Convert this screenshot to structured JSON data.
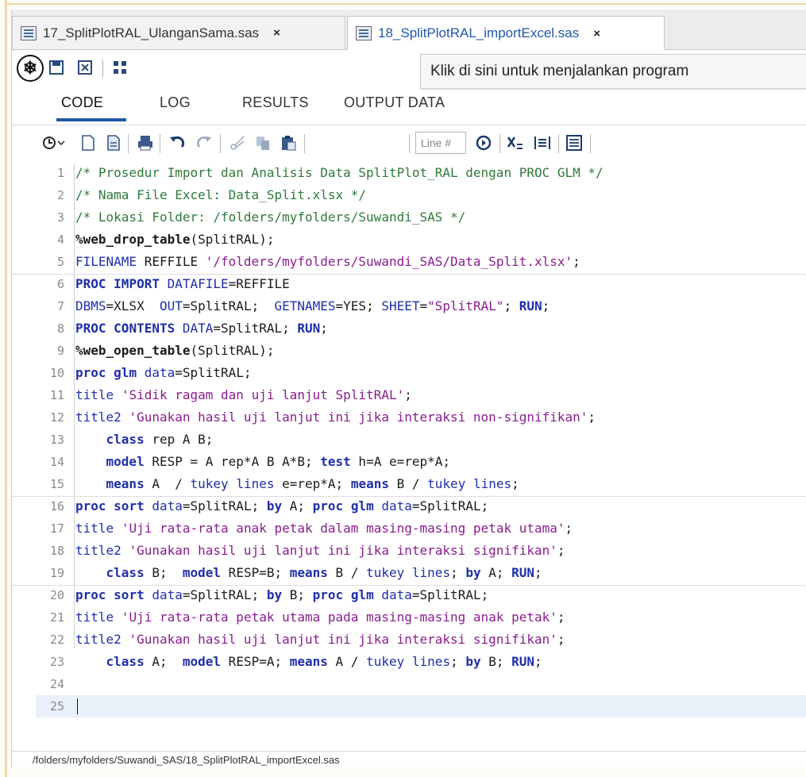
{
  "tabs": [
    {
      "label": "17_SplitPlotRAL_UlanganSama.sas",
      "close": "×"
    },
    {
      "label": "18_SplitPlotRAL_importExcel.sas",
      "close": "×"
    }
  ],
  "tooltip": "Klik di sini untuk menjalankan program",
  "section_tabs": [
    "CODE",
    "LOG",
    "RESULTS",
    "OUTPUT DATA"
  ],
  "linebox_placeholder": "Line #",
  "code_lines": [
    {
      "n": "1",
      "text": "/* Prosedur Import dan Analisis Data SplitPlot_RAL dengan PROC GLM */"
    },
    {
      "n": "2",
      "text": "/* Nama File Excel: Data_Split.xlsx */"
    },
    {
      "n": "3",
      "text": "/* Lokasi Folder: /folders/myfolders/Suwandi_SAS */"
    },
    {
      "n": "4",
      "text": "%web_drop_table(SplitRAL);"
    },
    {
      "n": "5",
      "text": "FILENAME REFFILE '/folders/myfolders/Suwandi_SAS/Data_Split.xlsx';"
    },
    {
      "n": "6",
      "text": "PROC IMPORT DATAFILE=REFFILE"
    },
    {
      "n": "7",
      "text": "DBMS=XLSX  OUT=SplitRAL;  GETNAMES=YES; SHEET=\"SplitRAL\"; RUN;"
    },
    {
      "n": "8",
      "text": "PROC CONTENTS DATA=SplitRAL; RUN;"
    },
    {
      "n": "9",
      "text": "%web_open_table(SplitRAL);"
    },
    {
      "n": "10",
      "text": "proc glm data=SplitRAL;"
    },
    {
      "n": "11",
      "text": "title 'Sidik ragam dan uji lanjut SplitRAL';"
    },
    {
      "n": "12",
      "text": "title2 'Gunakan hasil uji lanjut ini jika interaksi non-signifikan';"
    },
    {
      "n": "13",
      "text": "    class rep A B;"
    },
    {
      "n": "14",
      "text": "    model RESP = A rep*A B A*B; test h=A e=rep*A;"
    },
    {
      "n": "15",
      "text": "    means A  / tukey lines e=rep*A; means B / tukey lines;"
    },
    {
      "n": "16",
      "text": "proc sort data=SplitRAL; by A; proc glm data=SplitRAL;"
    },
    {
      "n": "17",
      "text": "title 'Uji rata-rata anak petak dalam masing-masing petak utama';"
    },
    {
      "n": "18",
      "text": "title2 'Gunakan hasil uji lanjut ini jika interaksi signifikan';"
    },
    {
      "n": "19",
      "text": "    class B;  model RESP=B; means B / tukey lines; by A; RUN;"
    },
    {
      "n": "20",
      "text": "proc sort data=SplitRAL; by B; proc glm data=SplitRAL;"
    },
    {
      "n": "21",
      "text": "title 'Uji rata-rata petak utama pada masing-masing anak petak';"
    },
    {
      "n": "22",
      "text": "title2 'Gunakan hasil uji lanjut ini jika interaksi signifikan';"
    },
    {
      "n": "23",
      "text": "    class A;  model RESP=A; means A / tukey lines; by B; RUN;"
    },
    {
      "n": "24",
      "text": ""
    },
    {
      "n": "25",
      "text": ""
    }
  ],
  "status_path": "/folders/myfolders/Suwandi_SAS/18_SplitPlotRAL_importExcel.sas",
  "colors": {
    "accent": "#1f56a8",
    "comment": "#2f7a3a",
    "keyword": "#1f2fa8",
    "string": "#8a1d8e"
  }
}
